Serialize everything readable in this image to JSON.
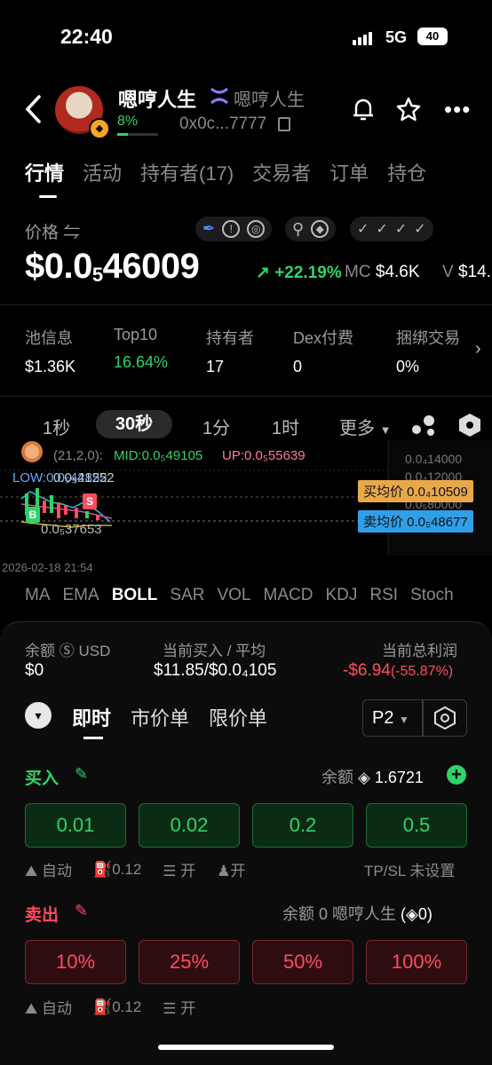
{
  "status_bar": {
    "time": "22:40",
    "network": "5G",
    "battery": "40"
  },
  "header": {
    "title": "嗯哼人生",
    "chain_name": "嗯哼人生",
    "holder_pct": "8%",
    "address": "0x0c...7777",
    "icons": [
      "back-arrow-icon",
      "bell-icon",
      "star-icon",
      "more-icon"
    ]
  },
  "tabs": [
    {
      "label": "行情",
      "active": true
    },
    {
      "label": "活动"
    },
    {
      "label": "持有者(17)"
    },
    {
      "label": "交易者"
    },
    {
      "label": "订单"
    },
    {
      "label": "持仓"
    }
  ],
  "price": {
    "label": "价格 ⇋",
    "main": "$0.0",
    "sub": "5",
    "rest": "46009",
    "change": "+22.19%",
    "mc_label": "MC",
    "mc_value": "$4.6K",
    "vol_label": "V",
    "vol_value": "$14."
  },
  "pool_info": [
    {
      "label": "池信息",
      "value": "$1.36K"
    },
    {
      "label": "Top10",
      "value": "16.64%"
    },
    {
      "label": "持有者",
      "value": "17"
    },
    {
      "label": "Dex付费",
      "value": "0"
    },
    {
      "label": "捆绑交易",
      "value": "0%"
    }
  ],
  "timeframes": [
    "1秒",
    "30秒",
    "1分",
    "1时",
    "更多"
  ],
  "chart": {
    "boll_params": "(21,2,0):",
    "mid": "MID:0.0₅49105",
    "up": "UP:0.0₅55639",
    "low": "LOW:0.0₅42852",
    "low_label": "0.0₅41252",
    "bottom_label": "0.0₅37653",
    "axis_1": "0.0₄14000",
    "axis_2": "0.0₄12000",
    "axis_3": "0.0₅80000",
    "avg_buy": "买均价 0.0₄10509",
    "avg_sell": "卖均价 0.0₅48677",
    "date": "2026-02-18 21:54",
    "b_marker": "B",
    "s_marker": "S"
  },
  "indicators": [
    "MA",
    "EMA",
    "BOLL",
    "SAR",
    "VOL",
    "MACD",
    "KDJ",
    "RSI",
    "Stoch"
  ],
  "trade_panel": {
    "balance_label": "余额",
    "balance_unit": "USD",
    "balance_value": "$0",
    "current_buy_label": "当前买入 / 平均",
    "current_buy_value": "$11.85/$0.0₄105",
    "pnl_label": "当前总利润",
    "pnl_value": "-$6.94",
    "pnl_pct": "(-55.87%)",
    "modes": [
      "即时",
      "市价单",
      "限价单"
    ],
    "preset": "P2",
    "buy_label": "买入",
    "buy_balance_label": "余额",
    "buy_balance_value": "1.6721",
    "buy_amounts": [
      "0.01",
      "0.02",
      "0.2",
      "0.5"
    ],
    "opt_auto": "自动",
    "opt_gas": "0.12",
    "opt_mev": "开",
    "opt_user": "开",
    "tpsl": "TP/SL 未设置",
    "sell_label": "卖出",
    "sell_balance": "余额 0 嗯哼人生",
    "sell_balance_extra": "0)",
    "sell_amounts": [
      "10%",
      "25%",
      "50%",
      "100%"
    ]
  }
}
